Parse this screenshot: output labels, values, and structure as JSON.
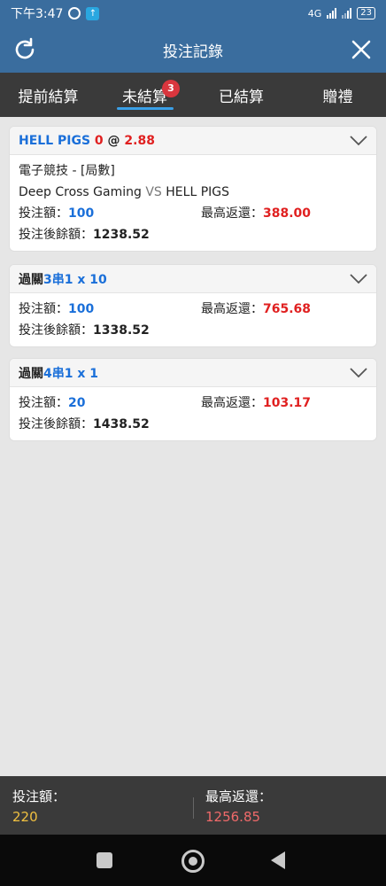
{
  "status_bar": {
    "time": "下午3:47",
    "network": "4G",
    "battery": "23"
  },
  "header": {
    "title": "投注記錄",
    "refresh_icon": "refresh-icon",
    "close_icon": "close-icon"
  },
  "tabs": [
    {
      "label": "提前結算"
    },
    {
      "label": "未結算",
      "badge": "3",
      "active": true
    },
    {
      "label": "已結算"
    },
    {
      "label": "贈禮"
    }
  ],
  "bets": [
    {
      "head_team": "HELL PIGS",
      "head_score": "0",
      "head_at": "@",
      "head_odds": "2.88",
      "category": "電子競技 - [局數]",
      "match_home": "Deep Cross Gaming",
      "match_vs": "VS",
      "match_away": "HELL PIGS",
      "stake_label": "投注額：",
      "stake": "100",
      "max_return_label": "最高返還：",
      "max_return": "388.00",
      "balance_label": "投注後餘額：",
      "balance": "1238.52"
    },
    {
      "head_prefix": "過關",
      "head_combo": "3串1 x 10",
      "stake_label": "投注額：",
      "stake": "100",
      "max_return_label": "最高返還：",
      "max_return": "765.68",
      "balance_label": "投注後餘額：",
      "balance": "1338.52"
    },
    {
      "head_prefix": "過關",
      "head_combo": "4串1 x 1",
      "stake_label": "投注額：",
      "stake": "20",
      "max_return_label": "最高返還：",
      "max_return": "103.17",
      "balance_label": "投注後餘額：",
      "balance": "1438.52"
    }
  ],
  "summary": {
    "stake_label": "投注額：",
    "stake_total": "220",
    "max_return_label": "最高返還：",
    "max_return_total": "1256.85"
  },
  "colors": {
    "header_bg": "#3a6d9e",
    "tab_bg": "#3a3a3a",
    "accent_blue": "#1a6fd9",
    "accent_red": "#e02020",
    "badge_red": "#d9363e"
  }
}
